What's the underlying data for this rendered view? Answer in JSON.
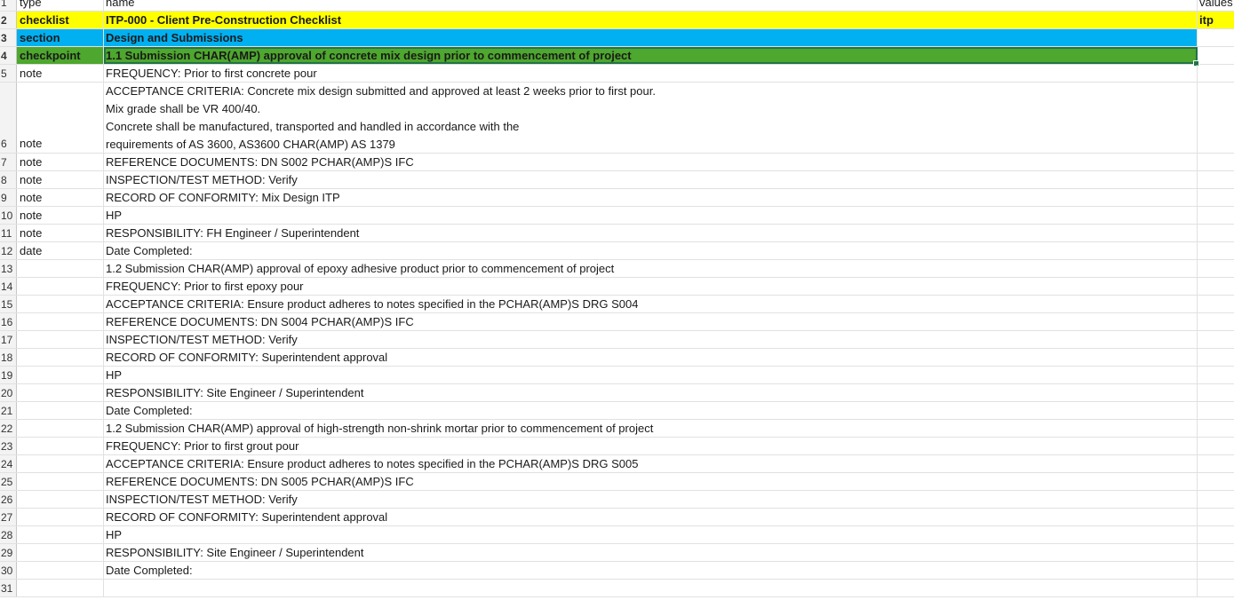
{
  "colors": {
    "checklist_row": "#ffff00",
    "section_row": "#00b0f0",
    "checkpoint_row": "#4ea72e",
    "selection": "#217346"
  },
  "rows": [
    {
      "num": "1",
      "a": "type",
      "b": "name",
      "c": "values"
    },
    {
      "num": "2",
      "a": "checklist",
      "b": "ITP-000 - Client Pre-Construction Checklist",
      "c": "itp"
    },
    {
      "num": "3",
      "a": "section",
      "b": "Design and Submissions",
      "c": ""
    },
    {
      "num": "4",
      "a": "checkpoint",
      "b": "1.1 Submission CHAR(AMP) approval of concrete mix design prior to commencement of project",
      "c": ""
    },
    {
      "num": "5",
      "a": "note",
      "b": "FREQUENCY: Prior to first concrete pour",
      "c": ""
    },
    {
      "num": "6",
      "a": "note",
      "lines": [
        "ACCEPTANCE CRITERIA: Concrete mix design submitted and approved  at least 2 weeks prior to first pour.",
        "Mix grade shall be VR 400/40.",
        "Concrete shall be manufactured, transported and handled in accordance with the",
        "requirements of AS 3600, AS3600 CHAR(AMP) AS 1379"
      ],
      "c": ""
    },
    {
      "num": "7",
      "a": "note",
      "b": "REFERENCE DOCUMENTS: DN S002 PCHAR(AMP)S IFC",
      "c": ""
    },
    {
      "num": "8",
      "a": "note",
      "b": "INSPECTION/TEST METHOD: Verify",
      "c": ""
    },
    {
      "num": "9",
      "a": "note",
      "b": "RECORD OF CONFORMITY: Mix Design ITP",
      "c": ""
    },
    {
      "num": "10",
      "a": "note",
      "b": "HP",
      "c": ""
    },
    {
      "num": "11",
      "a": "note",
      "b": "RESPONSIBILITY: FH Engineer / Superintendent",
      "c": ""
    },
    {
      "num": "12",
      "a": "date",
      "b": "Date Completed:",
      "c": ""
    },
    {
      "num": "13",
      "a": "",
      "b": "1.2 Submission CHAR(AMP) approval of epoxy adhesive product prior to commencement of project",
      "c": ""
    },
    {
      "num": "14",
      "a": "",
      "b": "FREQUENCY: Prior to first epoxy pour",
      "c": ""
    },
    {
      "num": "15",
      "a": "",
      "b": "ACCEPTANCE CRITERIA: Ensure product adheres to notes specified in the PCHAR(AMP)S DRG S004",
      "c": ""
    },
    {
      "num": "16",
      "a": "",
      "b": "REFERENCE DOCUMENTS: DN S004 PCHAR(AMP)S IFC",
      "c": ""
    },
    {
      "num": "17",
      "a": "",
      "b": "INSPECTION/TEST METHOD: Verify",
      "c": ""
    },
    {
      "num": "18",
      "a": "",
      "b": "RECORD OF CONFORMITY: Superintendent approval",
      "c": ""
    },
    {
      "num": "19",
      "a": "",
      "b": "HP",
      "c": ""
    },
    {
      "num": "20",
      "a": "",
      "b": "RESPONSIBILITY: Site Engineer / Superintendent",
      "c": ""
    },
    {
      "num": "21",
      "a": "",
      "b": "Date Completed:",
      "c": ""
    },
    {
      "num": "22",
      "a": "",
      "b": "1.2 Submission CHAR(AMP) approval of high-strength non-shrink mortar prior to commencement of project",
      "c": ""
    },
    {
      "num": "23",
      "a": "",
      "b": "FREQUENCY: Prior to first grout pour",
      "c": ""
    },
    {
      "num": "24",
      "a": "",
      "b": "ACCEPTANCE CRITERIA: Ensure product adheres to notes specified in the PCHAR(AMP)S DRG S005",
      "c": ""
    },
    {
      "num": "25",
      "a": "",
      "b": "REFERENCE DOCUMENTS: DN S005 PCHAR(AMP)S IFC",
      "c": ""
    },
    {
      "num": "26",
      "a": "",
      "b": "INSPECTION/TEST METHOD: Verify",
      "c": ""
    },
    {
      "num": "27",
      "a": "",
      "b": "RECORD OF CONFORMITY: Superintendent approval",
      "c": ""
    },
    {
      "num": "28",
      "a": "",
      "b": "HP",
      "c": ""
    },
    {
      "num": "29",
      "a": "",
      "b": "RESPONSIBILITY: Site Engineer / Superintendent",
      "c": ""
    },
    {
      "num": "30",
      "a": "",
      "b": "Date Completed:",
      "c": ""
    },
    {
      "num": "31",
      "a": "",
      "b": "",
      "c": ""
    }
  ]
}
